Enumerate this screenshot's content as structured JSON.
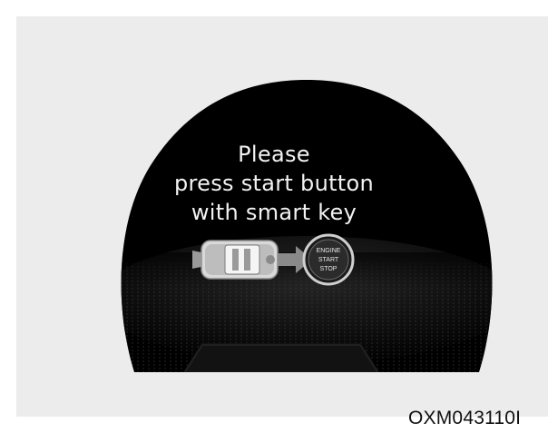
{
  "display": {
    "message_line1": "Please",
    "message_line2": "press start button",
    "message_line3": "with smart key"
  },
  "start_button": {
    "line1": "ENGINE",
    "line2": "START",
    "line3": "STOP"
  },
  "figure_code": "OXM043110I",
  "icons": {
    "smart_key": "smart-key-fob-icon",
    "arrow": "right-arrow-icon",
    "start_button": "engine-start-stop-button-icon"
  },
  "colors": {
    "background_panel": "#ececec",
    "display": "#000000",
    "text": "#f2f2f2",
    "arrow": "#8a8a8a"
  }
}
